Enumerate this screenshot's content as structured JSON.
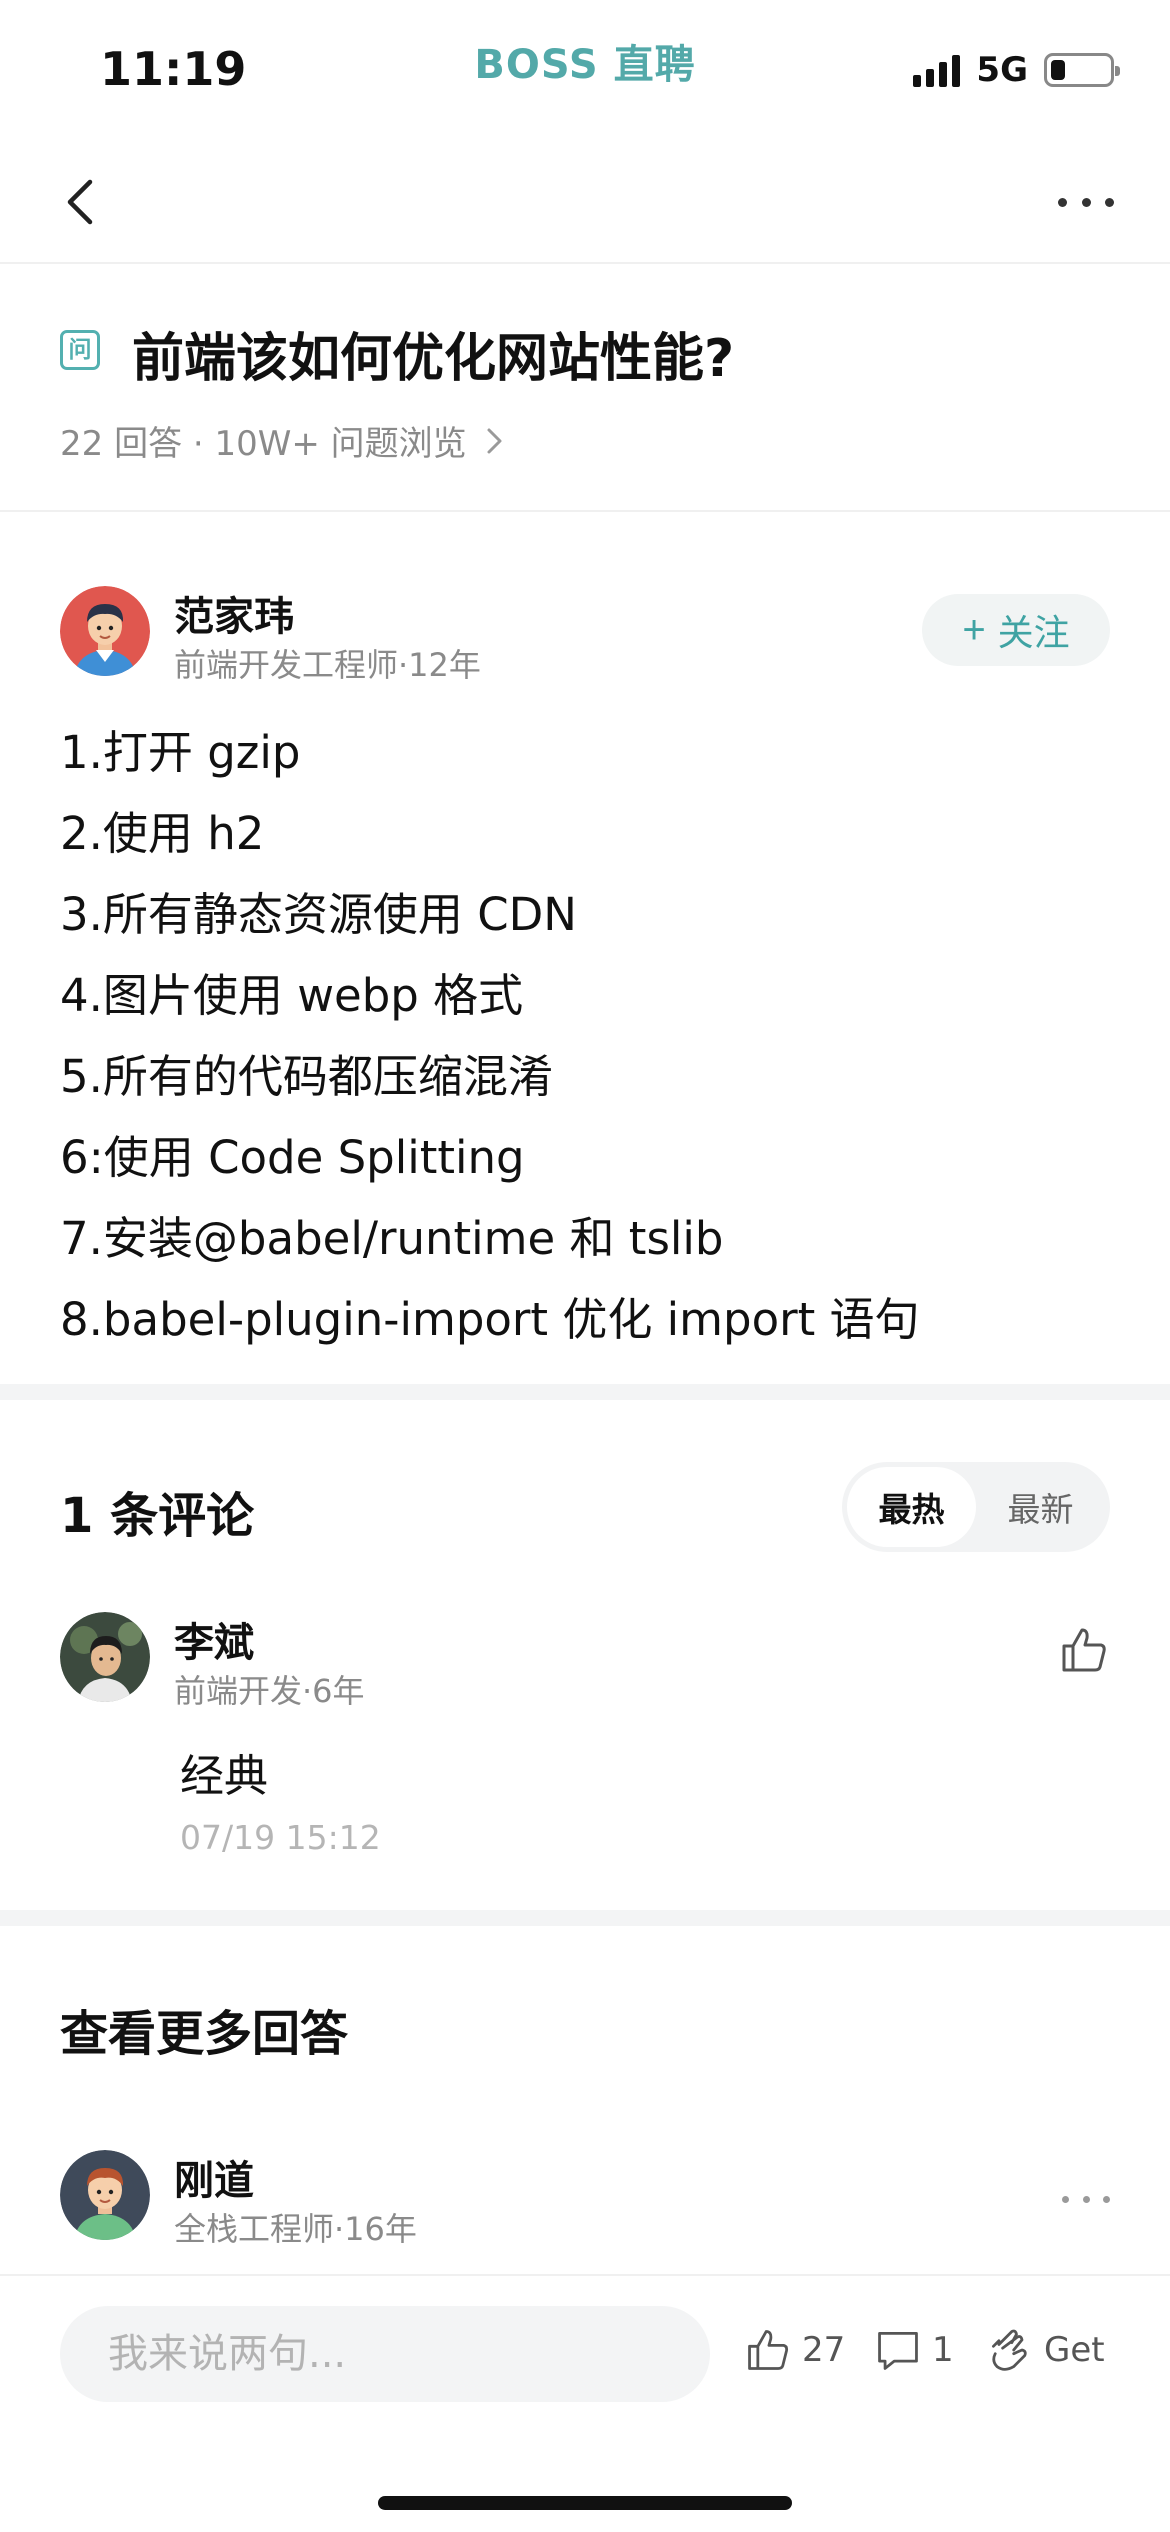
{
  "status_bar": {
    "time": "11:19",
    "app_name": "BOSS 直聘",
    "network": "5G",
    "battery_level": 0.25
  },
  "question": {
    "badge": "问",
    "title": "前端该如何优化网站性能?",
    "meta": "22 回答 · 10W+ 问题浏览"
  },
  "answer": {
    "author_name": "范家玮",
    "author_title": "前端开发工程师·12年",
    "follow_label": "关注",
    "follow_icon": "plus-icon",
    "items": [
      "1.打开 gzip",
      "2.使用 h2",
      "3.所有静态资源使用 CDN",
      "4.图片使用 webp 格式",
      "5.所有的代码都压缩混淆",
      "6:使用 Code Splitting",
      "7.安装@babel/runtime 和 tslib",
      "8.babel-plugin-import 优化 import 语句"
    ]
  },
  "comments": {
    "title": "1 条评论",
    "sort_options": [
      "最热",
      "最新"
    ],
    "active_sort": "最热",
    "items": [
      {
        "author": "李斌",
        "author_title": "前端开发·6年",
        "text": "经典",
        "time": "07/19 15:12"
      }
    ]
  },
  "more_answers": {
    "title": "查看更多回答",
    "first": {
      "author": "刚道",
      "author_title": "全栈工程师·16年"
    }
  },
  "bottom_bar": {
    "input_placeholder": "我来说两句...",
    "like_count": "27",
    "comment_count": "1",
    "get_label": "Get"
  },
  "colors": {
    "brand": "#53a9a9",
    "accent": "#3fa3a3",
    "muted": "#8a8a8a"
  }
}
